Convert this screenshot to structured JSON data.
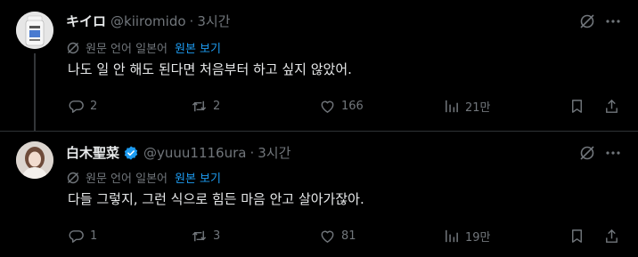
{
  "tweets": [
    {
      "display_name": "キイロ",
      "handle": "@kiiromido",
      "separator": "·",
      "time": "3시간",
      "verified": false,
      "translate_note": "원문 언어 일본어",
      "show_original": "원본 보기",
      "text": "나도 일 안 해도 된다면 처음부터 하고 싶지 않았어.",
      "replies": "2",
      "retweets": "2",
      "likes": "166",
      "views": "21만"
    },
    {
      "display_name": "白木聖菜",
      "handle": "@yuuu1116ura",
      "separator": "·",
      "time": "3시간",
      "verified": true,
      "translate_note": "원문 언어 일본어",
      "show_original": "원본 보기",
      "text": "다들 그렇지, 그런 식으로 힘든 마음 안고 살아가잖아.",
      "replies": "1",
      "retweets": "3",
      "likes": "81",
      "views": "19만"
    }
  ],
  "icons": {
    "verified": "verified-badge-icon",
    "grok": "grok-icon",
    "more": "more-icon",
    "translate": "translate-icon",
    "reply": "reply-icon",
    "retweet": "retweet-icon",
    "like": "heart-icon",
    "views": "views-icon",
    "bookmark": "bookmark-icon",
    "share": "share-icon"
  },
  "colors": {
    "background": "#000000",
    "text": "#e7e9ea",
    "muted": "#71767b",
    "accent": "#1d9bf0",
    "divider": "#2f3336"
  }
}
